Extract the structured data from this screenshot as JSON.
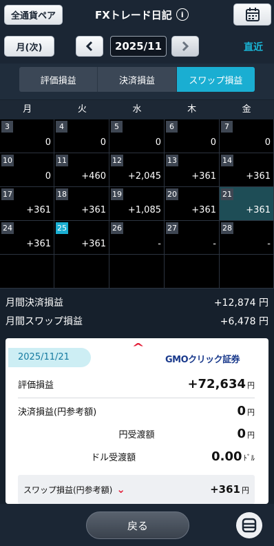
{
  "header": {
    "pair_button": "全通貨ペア",
    "title": "FXトレード日記",
    "info_icon": "i",
    "calendar_icon": "calendar-icon",
    "mode_button": "月(次)",
    "prev_icon": "chevron-left-icon",
    "month": "2025/11",
    "next_icon": "chevron-right-icon",
    "recent_link": "直近"
  },
  "tabs": [
    {
      "label": "評価損益",
      "active": false
    },
    {
      "label": "決済損益",
      "active": false
    },
    {
      "label": "スワップ損益",
      "active": true
    }
  ],
  "weekdays": [
    "月",
    "火",
    "水",
    "木",
    "金"
  ],
  "calendar": {
    "weeks": [
      [
        {
          "day": "3",
          "value": "0"
        },
        {
          "day": "4",
          "value": "0"
        },
        {
          "day": "5",
          "value": "0"
        },
        {
          "day": "6",
          "value": "0"
        },
        {
          "day": "7",
          "value": "0"
        }
      ],
      [
        {
          "day": "10",
          "value": "0"
        },
        {
          "day": "11",
          "value": "+460"
        },
        {
          "day": "12",
          "value": "+2,045"
        },
        {
          "day": "13",
          "value": "+361"
        },
        {
          "day": "14",
          "value": "+361"
        }
      ],
      [
        {
          "day": "17",
          "value": "+361"
        },
        {
          "day": "18",
          "value": "+361"
        },
        {
          "day": "19",
          "value": "+1,085"
        },
        {
          "day": "20",
          "value": "+361"
        },
        {
          "day": "21",
          "value": "+361",
          "selected": true
        }
      ],
      [
        {
          "day": "24",
          "value": "+361"
        },
        {
          "day": "25",
          "value": "+361",
          "today": true
        },
        {
          "day": "26",
          "value": "-"
        },
        {
          "day": "27",
          "value": "-"
        },
        {
          "day": "28",
          "value": "-"
        }
      ],
      [
        {
          "day": "",
          "value": ""
        },
        {
          "day": "",
          "value": ""
        },
        {
          "day": "",
          "value": ""
        },
        {
          "day": "",
          "value": ""
        },
        {
          "day": "",
          "value": ""
        }
      ]
    ],
    "colors": {
      "selected": "#1e4d56",
      "today": "#1aaed2"
    }
  },
  "summary": {
    "settlement_label": "月間決済損益",
    "settlement_value": "+12,874 円",
    "swap_label": "月間スワップ損益",
    "swap_value": "+6,478 円"
  },
  "detail": {
    "date": "2025/11/21",
    "logo": "GMOクリック証券",
    "rows": {
      "valuation_label": "評価損益",
      "valuation_value": "+72,634",
      "valuation_unit": "円",
      "settle_label": "決済損益(円参考額)",
      "settle_value": "0",
      "settle_unit": "円",
      "yen_label": "円受渡額",
      "yen_value": "0",
      "yen_unit": "円",
      "dollar_label": "ドル受渡額",
      "dollar_value": "0.00",
      "dollar_unit": "ﾄﾞﾙ",
      "swap_label": "スワップ損益(円参考額)",
      "swap_value": "+361",
      "swap_unit": "円"
    }
  },
  "footer": {
    "back_button": "戻る",
    "menu_icon": "menu-icon"
  }
}
